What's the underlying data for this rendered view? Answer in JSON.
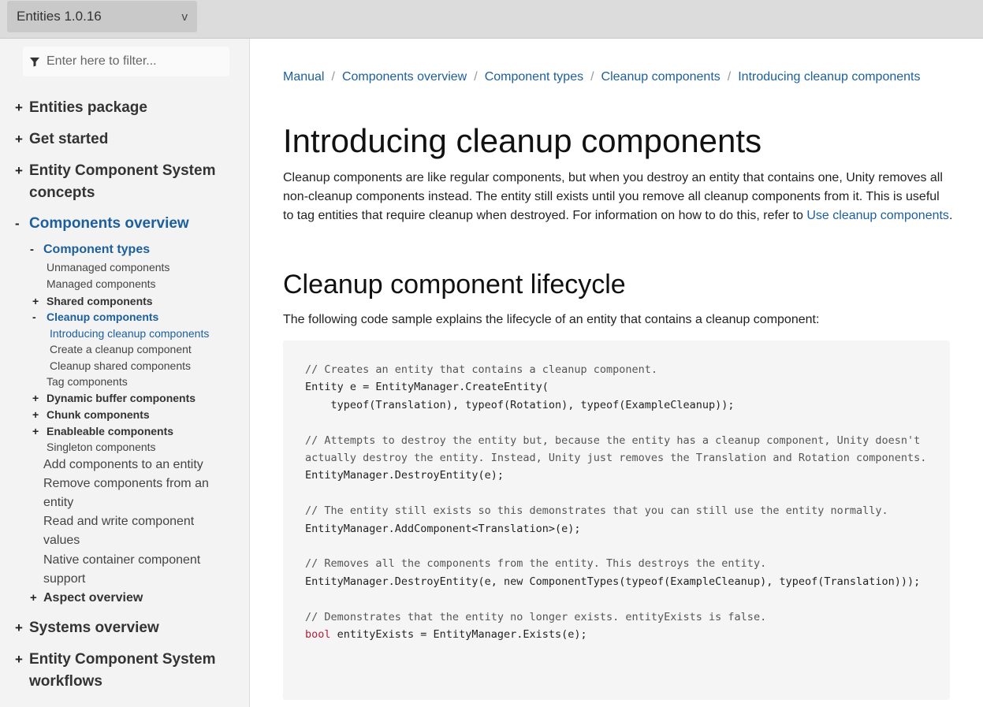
{
  "topbar": {
    "version": "Entities 1.0.16",
    "chevron": "v"
  },
  "sidebar": {
    "filter_placeholder": "Enter here to filter...",
    "items": {
      "entities_package": "Entities package",
      "get_started": "Get started",
      "ecs_concepts_1": "Entity Component System",
      "ecs_concepts_2": "concepts",
      "components_overview": "Components overview",
      "component_types": "Component types",
      "unmanaged": "Unmanaged components",
      "managed": "Managed components",
      "shared": "Shared components",
      "cleanup": "Cleanup components",
      "introducing_cleanup": "Introducing cleanup components",
      "create_cleanup": "Create a cleanup component",
      "cleanup_shared": "Cleanup shared components",
      "tag": "Tag components",
      "dynamic_buffer": "Dynamic buffer components",
      "chunk": "Chunk components",
      "enableable": "Enableable components",
      "singleton": "Singleton components",
      "add_components": "Add components to an entity",
      "remove_components_1": "Remove components from an",
      "remove_components_2": "entity",
      "read_write_1": "Read and write component",
      "read_write_2": "values",
      "native_container_1": "Native container component",
      "native_container_2": "support",
      "aspect_overview": "Aspect overview",
      "systems_overview": "Systems overview",
      "ecs_workflows_1": "Entity Component System",
      "ecs_workflows_2": "workflows"
    },
    "markers": {
      "plus": "+",
      "minus": "-"
    }
  },
  "main": {
    "breadcrumb": [
      "Manual",
      "Components overview",
      "Component types",
      "Cleanup components",
      "Introducing cleanup components"
    ],
    "breadcrumb_sep": "/",
    "title": "Introducing cleanup components",
    "intro_text": "Cleanup components are like regular components, but when you destroy an entity that contains one, Unity removes all non-cleanup components instead. The entity still exists until you remove all cleanup components from it. This is useful to tag entities that require cleanup when destroyed. For information on how to do this, refer to ",
    "intro_link": "Use cleanup components",
    "intro_end": ".",
    "section_title": "Cleanup component lifecycle",
    "code_intro": "The following code sample explains the lifecycle of an entity that contains a cleanup component:",
    "code": {
      "c1": "// Creates an entity that contains a cleanup component.",
      "l1": "Entity e = EntityManager.CreateEntity(",
      "l2": "    typeof(Translation), typeof(Rotation), typeof(ExampleCleanup));",
      "c2": "// Attempts to destroy the entity but, because the entity has a cleanup component, Unity doesn't actually destroy the entity. Instead, Unity just removes the Translation and Rotation components.",
      "l3": "EntityManager.DestroyEntity(e);",
      "c3": "// The entity still exists so this demonstrates that you can still use the entity normally.",
      "l4": "EntityManager.AddComponent<Translation>(e);",
      "c4": "// Removes all the components from the entity. This destroys the entity.",
      "l5": "EntityManager.DestroyEntity(e, new ComponentTypes(typeof(ExampleCleanup), typeof(Translation)));",
      "c5": "// Demonstrates that the entity no longer exists. entityExists is false.",
      "l6_kw": "bool",
      "l6_rest": " entityExists = EntityManager.Exists(e);"
    }
  }
}
